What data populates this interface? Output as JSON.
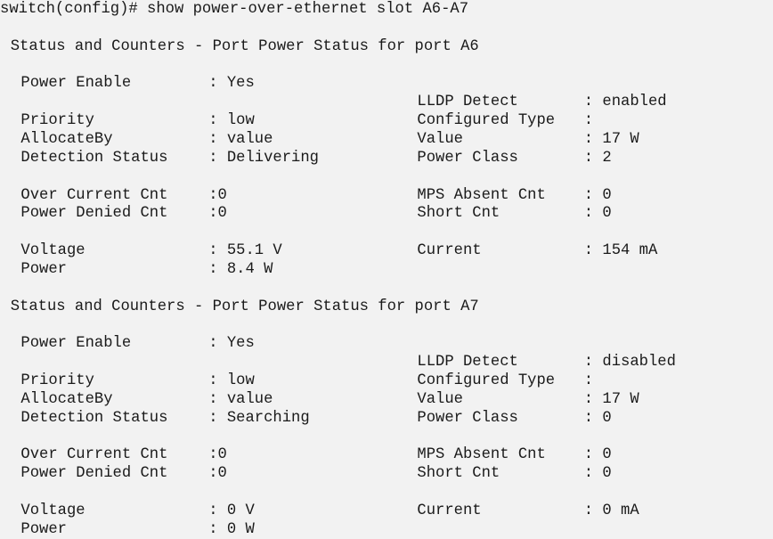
{
  "command_line": "switch(config)# show power-over-ethernet slot A6-A7",
  "lines": [
    {
      "row": 0,
      "cells": [
        {
          "col": 0,
          "text": "switch(config)# show power-over-ethernet slot A6-A7"
        }
      ]
    },
    {
      "row": 2,
      "cells": [
        {
          "col": 1,
          "text": "Status and Counters - Port Power Status for port A6"
        }
      ]
    },
    {
      "row": 4,
      "cells": [
        {
          "col": 2,
          "text": "Power Enable"
        },
        {
          "col": 20,
          "text": ": Yes"
        }
      ]
    },
    {
      "row": 5,
      "cells": [
        {
          "col": 40,
          "text": "LLDP Detect"
        },
        {
          "col": 56,
          "text": ": enabled"
        }
      ]
    },
    {
      "row": 6,
      "cells": [
        {
          "col": 2,
          "text": "Priority"
        },
        {
          "col": 20,
          "text": ": low"
        },
        {
          "col": 40,
          "text": "Configured Type"
        },
        {
          "col": 56,
          "text": ":"
        }
      ]
    },
    {
      "row": 7,
      "cells": [
        {
          "col": 2,
          "text": "AllocateBy"
        },
        {
          "col": 20,
          "text": ": value"
        },
        {
          "col": 40,
          "text": "Value"
        },
        {
          "col": 56,
          "text": ": 17 W"
        }
      ]
    },
    {
      "row": 8,
      "cells": [
        {
          "col": 2,
          "text": "Detection Status"
        },
        {
          "col": 20,
          "text": ": Delivering"
        },
        {
          "col": 40,
          "text": "Power Class"
        },
        {
          "col": 56,
          "text": ": 2"
        }
      ]
    },
    {
      "row": 10,
      "cells": [
        {
          "col": 2,
          "text": "Over Current Cnt"
        },
        {
          "col": 20,
          "text": ":0"
        },
        {
          "col": 40,
          "text": "MPS Absent Cnt"
        },
        {
          "col": 56,
          "text": ": 0"
        }
      ]
    },
    {
      "row": 11,
      "cells": [
        {
          "col": 2,
          "text": "Power Denied Cnt"
        },
        {
          "col": 20,
          "text": ":0"
        },
        {
          "col": 40,
          "text": "Short Cnt"
        },
        {
          "col": 56,
          "text": ": 0"
        }
      ]
    },
    {
      "row": 13,
      "cells": [
        {
          "col": 2,
          "text": "Voltage"
        },
        {
          "col": 20,
          "text": ": 55.1 V"
        },
        {
          "col": 40,
          "text": "Current"
        },
        {
          "col": 56,
          "text": ": 154 mA"
        }
      ]
    },
    {
      "row": 14,
      "cells": [
        {
          "col": 2,
          "text": "Power"
        },
        {
          "col": 20,
          "text": ": 8.4 W"
        }
      ]
    },
    {
      "row": 16,
      "cells": [
        {
          "col": 1,
          "text": "Status and Counters - Port Power Status for port A7"
        }
      ]
    },
    {
      "row": 18,
      "cells": [
        {
          "col": 2,
          "text": "Power Enable"
        },
        {
          "col": 20,
          "text": ": Yes"
        }
      ]
    },
    {
      "row": 19,
      "cells": [
        {
          "col": 40,
          "text": "LLDP Detect"
        },
        {
          "col": 56,
          "text": ": disabled"
        }
      ]
    },
    {
      "row": 20,
      "cells": [
        {
          "col": 2,
          "text": "Priority"
        },
        {
          "col": 20,
          "text": ": low"
        },
        {
          "col": 40,
          "text": "Configured Type"
        },
        {
          "col": 56,
          "text": ":"
        }
      ]
    },
    {
      "row": 21,
      "cells": [
        {
          "col": 2,
          "text": "AllocateBy"
        },
        {
          "col": 20,
          "text": ": value"
        },
        {
          "col": 40,
          "text": "Value"
        },
        {
          "col": 56,
          "text": ": 17 W"
        }
      ]
    },
    {
      "row": 22,
      "cells": [
        {
          "col": 2,
          "text": "Detection Status"
        },
        {
          "col": 20,
          "text": ": Searching"
        },
        {
          "col": 40,
          "text": "Power Class"
        },
        {
          "col": 56,
          "text": ": 0"
        }
      ]
    },
    {
      "row": 24,
      "cells": [
        {
          "col": 2,
          "text": "Over Current Cnt"
        },
        {
          "col": 20,
          "text": ":0"
        },
        {
          "col": 40,
          "text": "MPS Absent Cnt"
        },
        {
          "col": 56,
          "text": ": 0"
        }
      ]
    },
    {
      "row": 25,
      "cells": [
        {
          "col": 2,
          "text": "Power Denied Cnt"
        },
        {
          "col": 20,
          "text": ":0"
        },
        {
          "col": 40,
          "text": "Short Cnt"
        },
        {
          "col": 56,
          "text": ": 0"
        }
      ]
    },
    {
      "row": 27,
      "cells": [
        {
          "col": 2,
          "text": "Voltage"
        },
        {
          "col": 20,
          "text": ": 0 V"
        },
        {
          "col": 40,
          "text": "Current"
        },
        {
          "col": 56,
          "text": ": 0 mA"
        }
      ]
    },
    {
      "row": 28,
      "cells": [
        {
          "col": 2,
          "text": "Power"
        },
        {
          "col": 20,
          "text": ": 0 W"
        }
      ]
    }
  ]
}
